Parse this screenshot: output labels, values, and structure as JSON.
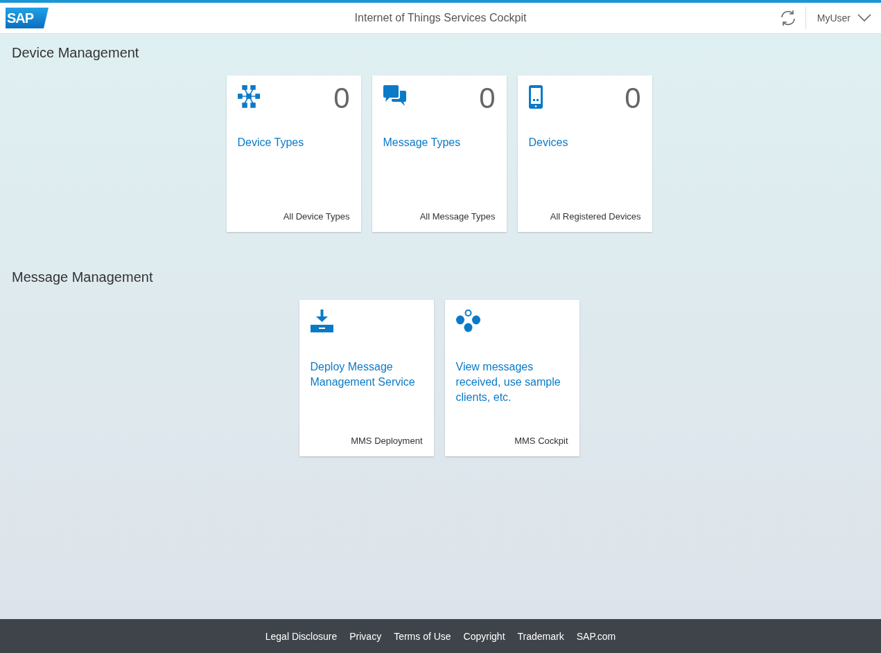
{
  "header": {
    "logo": "SAP",
    "title": "Internet of Things Services Cockpit",
    "user": "MyUser"
  },
  "sections": [
    {
      "title": "Device Management",
      "tiles": [
        {
          "kind": "network",
          "count": "0",
          "title": "Device Types",
          "footer": "All Device Types"
        },
        {
          "kind": "chat",
          "count": "0",
          "title": "Message Types",
          "footer": "All Message Types"
        },
        {
          "kind": "phone",
          "count": "0",
          "title": "Devices",
          "footer": "All Registered Devices"
        }
      ]
    },
    {
      "title": "Message Management",
      "tiles": [
        {
          "kind": "download",
          "title": "Deploy Message Management Service",
          "footer": "MMS Deployment"
        },
        {
          "kind": "dots",
          "title": "View messages received, use sample clients, etc.",
          "footer": "MMS Cockpit"
        }
      ]
    }
  ],
  "footer_links": [
    "Legal Disclosure",
    "Privacy",
    "Terms of Use",
    "Copyright",
    "Trademark",
    "SAP.com"
  ]
}
